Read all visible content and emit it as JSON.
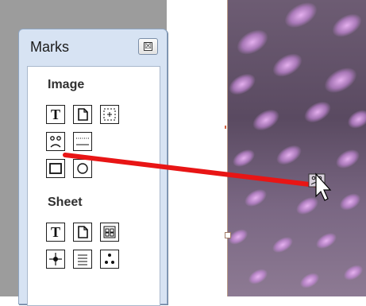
{
  "palette": {
    "title": "Marks",
    "close_glyph": "☒",
    "sections": {
      "image": {
        "label": "Image",
        "tools": [
          "text-mark-tool",
          "page-mark-tool",
          "region-mark-tool",
          "object-mark-tool",
          "ruler-mark-tool",
          "rectangle-mark-tool",
          "ellipse-mark-tool"
        ]
      },
      "sheet": {
        "label": "Sheet",
        "tools": [
          "text-mark-tool",
          "page-mark-tool",
          "grid-mark-tool",
          "center-mark-tool",
          "list-mark-tool",
          "dots-mark-tool"
        ]
      }
    }
  },
  "colors": {
    "drag_line": "#e81515",
    "palette_bg": "#d7e3f3"
  }
}
